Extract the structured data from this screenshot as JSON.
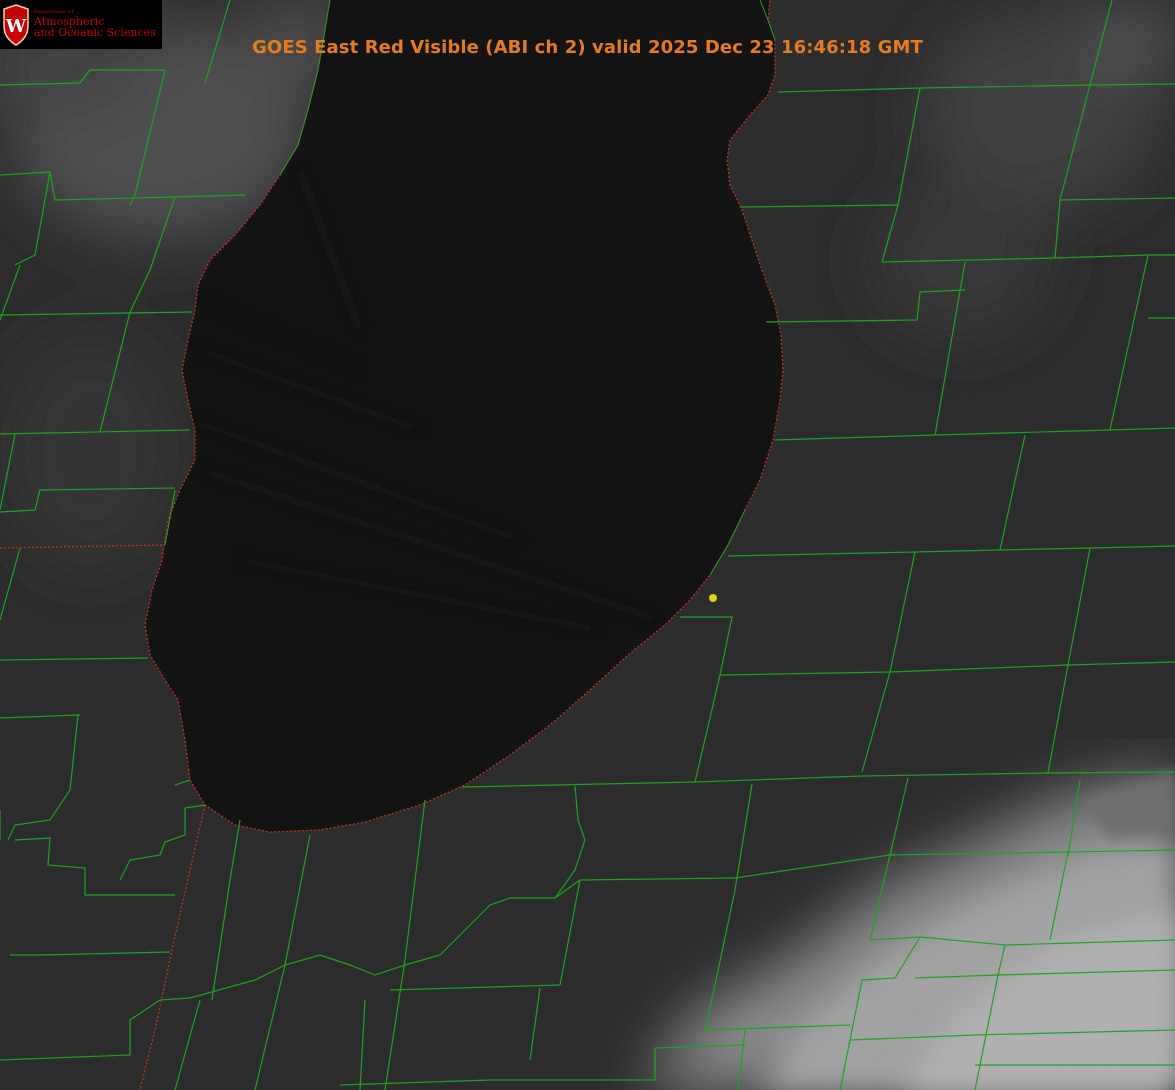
{
  "title": "GOES East Red Visible (ABI ch 2) valid 2025 Dec 23 16:46:18 GMT",
  "logo": {
    "shield_letter": "W",
    "department": "Department of",
    "line1": "Atmospheric",
    "line2": "and Oceanic Sciences",
    "icon": "uw-crest-icon"
  },
  "colors": {
    "title": "#e57b1f",
    "county_borders": "#1fa31f",
    "state_borders": "#cc3322",
    "marker": "#e0d020",
    "lake": "#0c0c0c",
    "land": "#262626",
    "cloud": "#9a9a9a"
  },
  "map": {
    "product": "GOES East Red Visible (ABI ch 2)",
    "marker": "location-dot"
  }
}
